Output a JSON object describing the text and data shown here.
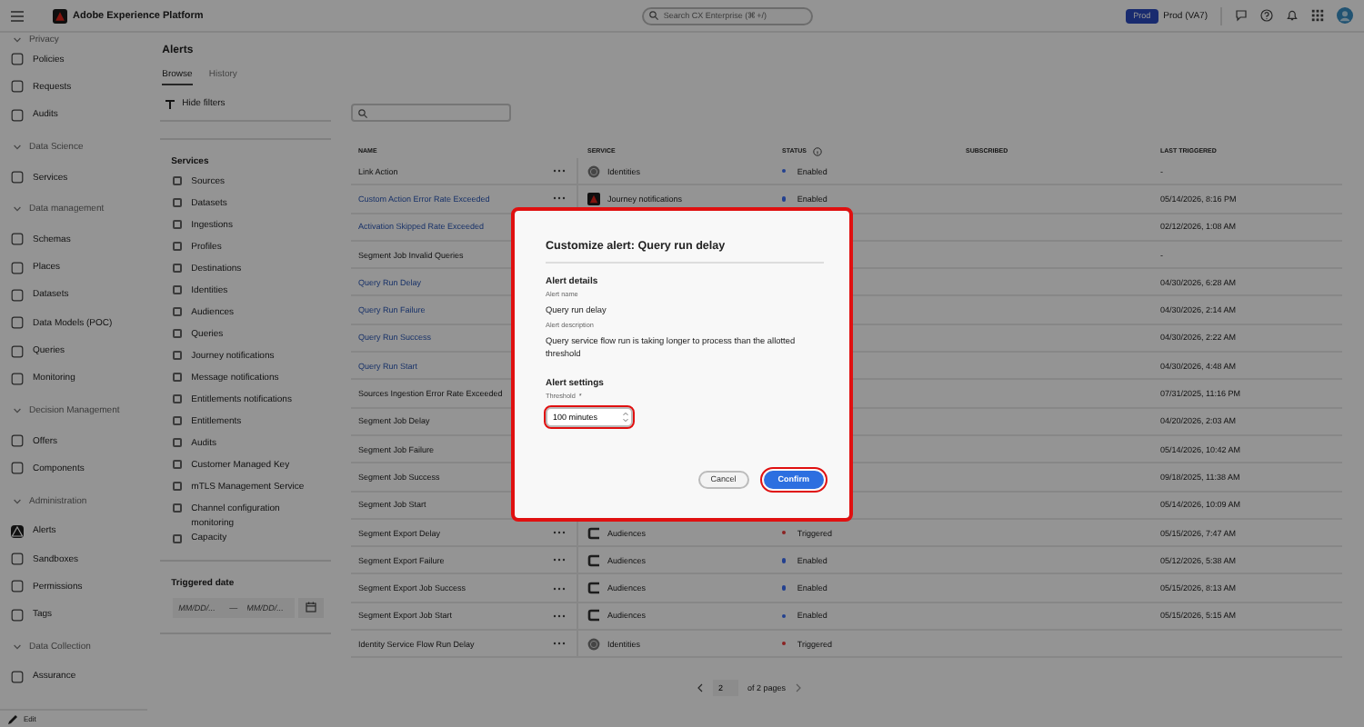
{
  "app": {
    "title": "Adobe Experience Platform",
    "search": {
      "placeholder": "Search CX Enterprise (⌘+/)"
    },
    "env_badge": "Prod",
    "env_name": "Prod (VA7)"
  },
  "nav": {
    "sections": [
      {
        "heading": "Privacy",
        "items": [
          {
            "label": "Policies",
            "selected": false
          },
          {
            "label": "Requests",
            "selected": false
          },
          {
            "label": "Audits",
            "selected": false
          }
        ]
      },
      {
        "heading": "Data Science",
        "items": [
          {
            "label": "Services",
            "selected": false
          }
        ]
      },
      {
        "heading": "Data management",
        "items": [
          {
            "label": "Schemas",
            "selected": false
          },
          {
            "label": "Places",
            "selected": false
          },
          {
            "label": "Datasets",
            "selected": false
          },
          {
            "label": "Data Models (POC)",
            "selected": false
          },
          {
            "label": "Queries",
            "selected": false
          },
          {
            "label": "Monitoring",
            "selected": false
          }
        ]
      },
      {
        "heading": "Decision Management",
        "items": [
          {
            "label": "Offers",
            "selected": false
          },
          {
            "label": "Components",
            "selected": false
          }
        ]
      },
      {
        "heading": "Administration",
        "items": [
          {
            "label": "Alerts",
            "selected": true
          },
          {
            "label": "Sandboxes",
            "selected": false
          },
          {
            "label": "Permissions",
            "selected": false
          },
          {
            "label": "Tags",
            "selected": false
          }
        ]
      },
      {
        "heading": "Data Collection",
        "items": [
          {
            "label": "Assurance",
            "selected": false
          }
        ]
      }
    ],
    "footer": "Edit"
  },
  "page": {
    "title": "Alerts",
    "tabs": [
      {
        "label": "Browse",
        "selected": true
      },
      {
        "label": "History",
        "selected": false
      }
    ]
  },
  "filters": {
    "toggle": "Hide filters",
    "services": {
      "heading": "Services",
      "options": [
        {
          "label": "Sources",
          "checked": false
        },
        {
          "label": "Datasets",
          "checked": false
        },
        {
          "label": "Ingestions",
          "checked": false
        },
        {
          "label": "Profiles",
          "checked": false
        },
        {
          "label": "Destinations",
          "checked": false
        },
        {
          "label": "Identities",
          "checked": false
        },
        {
          "label": "Audiences",
          "checked": false
        },
        {
          "label": "Queries",
          "checked": false
        },
        {
          "label": "Journey notifications",
          "checked": false
        },
        {
          "label": "Message notifications",
          "checked": false
        },
        {
          "label": "Entitlements notifications",
          "checked": false
        },
        {
          "label": "Entitlements",
          "checked": false
        },
        {
          "label": "Audits",
          "checked": false
        },
        {
          "label": "Customer Managed Key",
          "checked": false
        },
        {
          "label": "mTLS Management Service",
          "checked": false
        },
        {
          "label": "Channel configuration monitoring",
          "checked": false
        },
        {
          "label": "Capacity",
          "checked": false
        }
      ]
    },
    "triggered_date": {
      "heading": "Triggered date",
      "start": {
        "placeholder": "MM/DD/..."
      },
      "separator": "—",
      "end": {
        "placeholder": "MM/DD/..."
      }
    }
  },
  "table": {
    "columns": [
      "NAME",
      "SERVICE",
      "STATUS",
      "SUBSCRIBED",
      "LAST TRIGGERED"
    ],
    "rows": [
      {
        "name": "Link Action",
        "link": false,
        "service": {
          "name": "Identities",
          "kind": "identity"
        },
        "status": "Enabled",
        "color": "#23408f",
        "last_triggered": "-"
      },
      {
        "name": "Custom Action Error Rate Exceeded",
        "link": true,
        "service": {
          "name": "Journey notifications",
          "kind": "journey"
        },
        "status": "Enabled",
        "color": "#23408f",
        "last_triggered": "05/14/2026, 8:16 PM"
      },
      {
        "name": "Activation Skipped Rate Exceeded",
        "link": true,
        "last_triggered": "02/12/2026, 1:08 AM"
      },
      {
        "name": "Segment Job Invalid Queries",
        "link": false,
        "last_triggered": "-"
      },
      {
        "name": "Query Run Delay",
        "link": true,
        "last_triggered": "04/30/2026, 6:28 AM"
      },
      {
        "name": "Query Run Failure",
        "link": true,
        "last_triggered": "04/30/2026, 2:14 AM"
      },
      {
        "name": "Query Run Success",
        "link": true,
        "last_triggered": "04/30/2026, 2:22 AM"
      },
      {
        "name": "Query Run Start",
        "link": true,
        "last_triggered": "04/30/2026, 4:48 AM"
      },
      {
        "name": "Sources Ingestion Error Rate Exceeded",
        "link": false,
        "last_triggered": "07/31/2025, 11:16 PM"
      },
      {
        "name": "Segment Job Delay",
        "link": false,
        "last_triggered": "04/20/2026, 2:03 AM"
      },
      {
        "name": "Segment Job Failure",
        "link": false,
        "last_triggered": "05/14/2026, 10:42 AM"
      },
      {
        "name": "Segment Job Success",
        "link": false,
        "last_triggered": "09/18/2025, 11:38 AM"
      },
      {
        "name": "Segment Job Start",
        "link": false,
        "last_triggered": "05/14/2026, 10:09 AM"
      },
      {
        "name": "Segment Export Delay",
        "link": false,
        "service": {
          "name": "Audiences",
          "kind": "audience"
        },
        "status": "Triggered",
        "color": "#8a2222",
        "last_triggered": "05/15/2026, 7:47 AM"
      },
      {
        "name": "Segment Export Failure",
        "link": false,
        "service": {
          "name": "Audiences",
          "kind": "audience"
        },
        "status": "Enabled",
        "color": "#23408f",
        "last_triggered": "05/12/2026, 5:38 AM"
      },
      {
        "name": "Segment Export Job Success",
        "link": false,
        "service": {
          "name": "Audiences",
          "kind": "audience"
        },
        "status": "Enabled",
        "color": "#23408f",
        "last_triggered": "05/15/2026, 8:13 AM"
      },
      {
        "name": "Segment Export Job Start",
        "link": false,
        "service": {
          "name": "Audiences",
          "kind": "audience"
        },
        "status": "Enabled",
        "color": "#23408f",
        "last_triggered": "05/15/2026, 5:15 AM"
      },
      {
        "name": "Identity Service Flow Run Delay",
        "link": false,
        "service": {
          "name": "Identities",
          "kind": "identity"
        },
        "status": "Triggered",
        "color": "#8a2222"
      }
    ]
  },
  "pagination": {
    "page": "2",
    "total": "of 2 pages"
  },
  "dialog": {
    "title": "Customize alert: Query run delay",
    "highlighted": true,
    "details_heading": "Alert details",
    "name_label": "Alert name",
    "name_value": "Query run delay",
    "description_label": "Alert description",
    "description": "Query service flow run is taking longer to process than the allotted threshold",
    "settings_heading": "Alert settings",
    "threshold": {
      "label": "Threshold",
      "required": "*",
      "value": "100 minutes",
      "highlighted": true
    },
    "buttons": [
      {
        "label": "Cancel",
        "kind": "secondary",
        "highlighted": false
      },
      {
        "label": "Confirm",
        "kind": "primary",
        "highlighted": true
      }
    ]
  }
}
